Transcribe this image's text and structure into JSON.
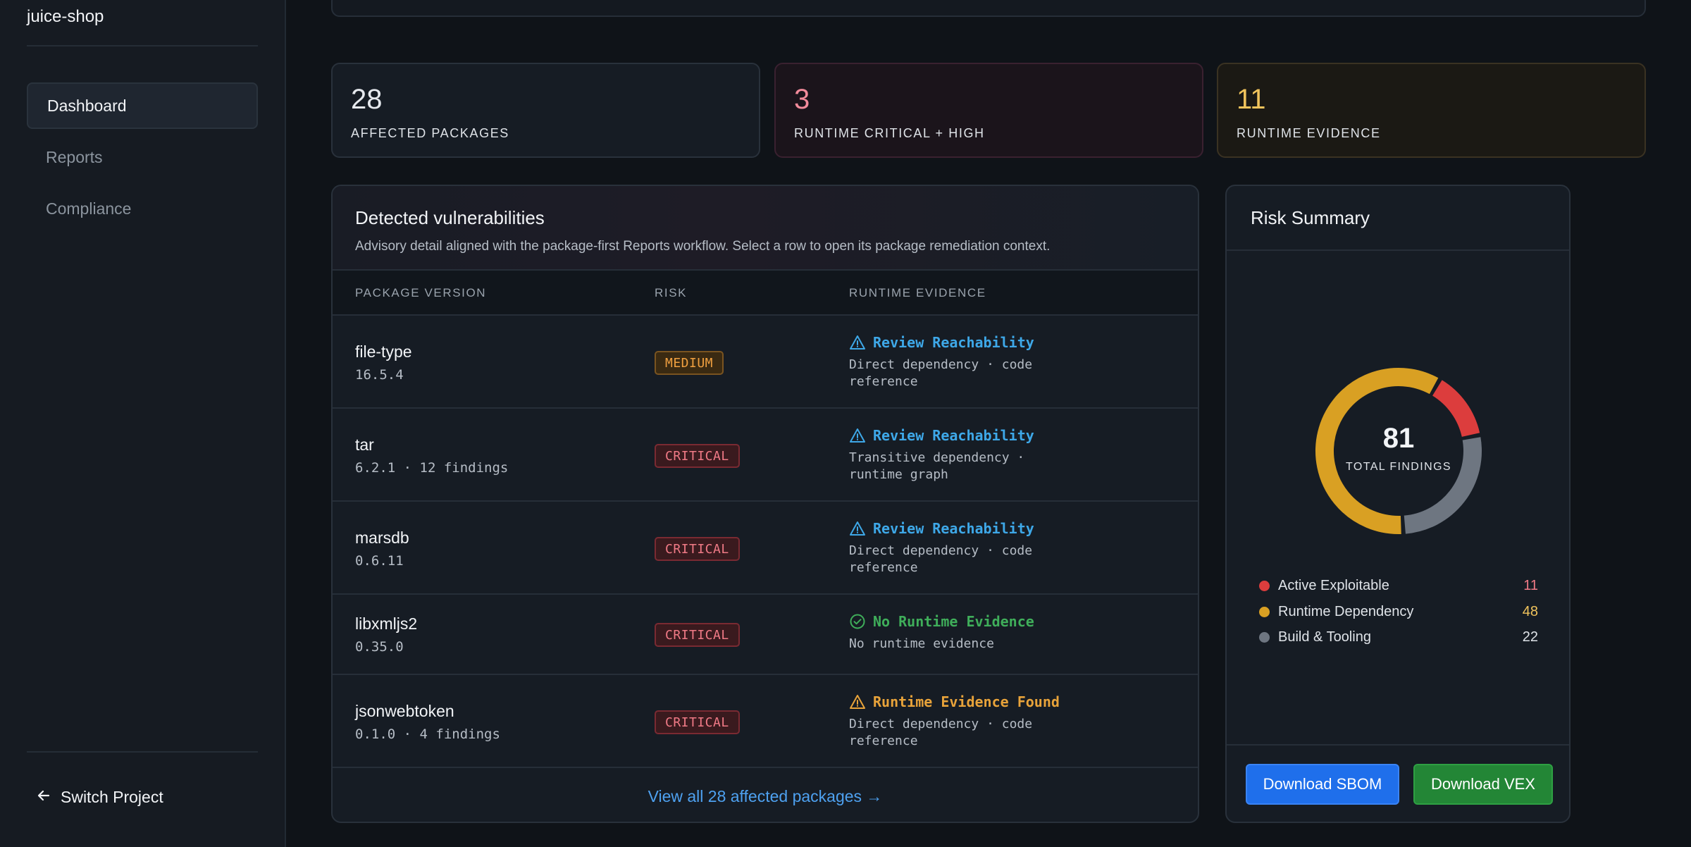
{
  "sidebar": {
    "project_name": "juice-shop",
    "nav": [
      {
        "label": "Dashboard",
        "active": true
      },
      {
        "label": "Reports",
        "active": false
      },
      {
        "label": "Compliance",
        "active": false
      }
    ],
    "switch_project": "Switch Project"
  },
  "stats": [
    {
      "value": "28",
      "label": "AFFECTED PACKAGES"
    },
    {
      "value": "3",
      "label": "RUNTIME CRITICAL + HIGH"
    },
    {
      "value": "11",
      "label": "RUNTIME EVIDENCE"
    }
  ],
  "vulnerabilities": {
    "title": "Detected vulnerabilities",
    "subtitle": "Advisory detail aligned with the package-first Reports workflow. Select a row to open its package remediation context.",
    "columns": [
      "PACKAGE VERSION",
      "RISK",
      "RUNTIME EVIDENCE"
    ],
    "rows": [
      {
        "package": "file-type",
        "version": "16.5.4",
        "risk": "MEDIUM",
        "evidence": "Review Reachability",
        "evidence_icon": "warning-triangle-icon",
        "detail": "Direct dependency · code reference"
      },
      {
        "package": "tar",
        "version": "6.2.1 · 12 findings",
        "risk": "CRITICAL",
        "evidence": "Review Reachability",
        "evidence_icon": "warning-triangle-icon",
        "detail": "Transitive dependency · runtime graph"
      },
      {
        "package": "marsdb",
        "version": "0.6.11",
        "risk": "CRITICAL",
        "evidence": "Review Reachability",
        "evidence_icon": "warning-triangle-icon",
        "detail": "Direct dependency · code reference"
      },
      {
        "package": "libxmljs2",
        "version": "0.35.0",
        "risk": "CRITICAL",
        "evidence": "No Runtime Evidence",
        "evidence_icon": "check-circle-icon",
        "detail": "No runtime evidence"
      },
      {
        "package": "jsonwebtoken",
        "version": "0.1.0 · 4 findings",
        "risk": "CRITICAL",
        "evidence": "Runtime Evidence Found",
        "evidence_icon": "warning-triangle-icon",
        "detail": "Direct dependency · code reference"
      }
    ],
    "view_all": "View all 28 affected packages →"
  },
  "risk_summary": {
    "title": "Risk Summary",
    "total": "81",
    "total_label": "TOTAL FINDINGS",
    "segments": [
      {
        "label": "Active Exploitable",
        "value": 11,
        "color": "#dc3d3d"
      },
      {
        "label": "Runtime Dependency",
        "value": 48,
        "color": "#d9a023"
      },
      {
        "label": "Build & Tooling",
        "value": 22,
        "color": "#6e7681"
      }
    ],
    "download_sbom": "Download SBOM",
    "download_vex": "Download VEX"
  },
  "colors": {
    "accent_blue": "#1f6feb",
    "accent_green": "#238636",
    "critical": "#f07a86",
    "medium": "#f0a040"
  }
}
